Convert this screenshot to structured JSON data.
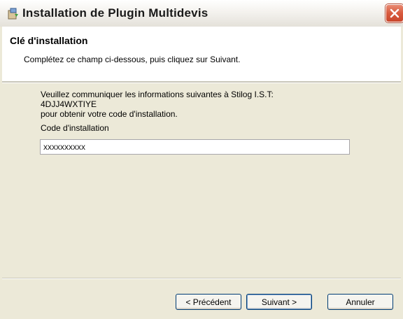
{
  "window": {
    "title": "Installation de Plugin Multidevis"
  },
  "header": {
    "heading": "Clé d'installation",
    "subheading": "Complétez ce champ ci-dessous, puis cliquez sur Suivant."
  },
  "body": {
    "line1": "Veuillez communiquer les informations suivantes à Stilog I.S.T:",
    "line2": "4DJJ4WXTIYE",
    "line3": "pour obtenir votre code d'installation.",
    "code_label": "Code d'installation",
    "code_value": "xxxxxxxxxx"
  },
  "buttons": {
    "previous": "< Précédent",
    "next": "Suivant >",
    "cancel": "Annuler"
  },
  "icons": {
    "app": "installer-icon",
    "close": "close-icon"
  },
  "colors": {
    "close_button": "#d85a3e",
    "dialog_bg": "#ece9d8",
    "button_border": "#003c74"
  }
}
